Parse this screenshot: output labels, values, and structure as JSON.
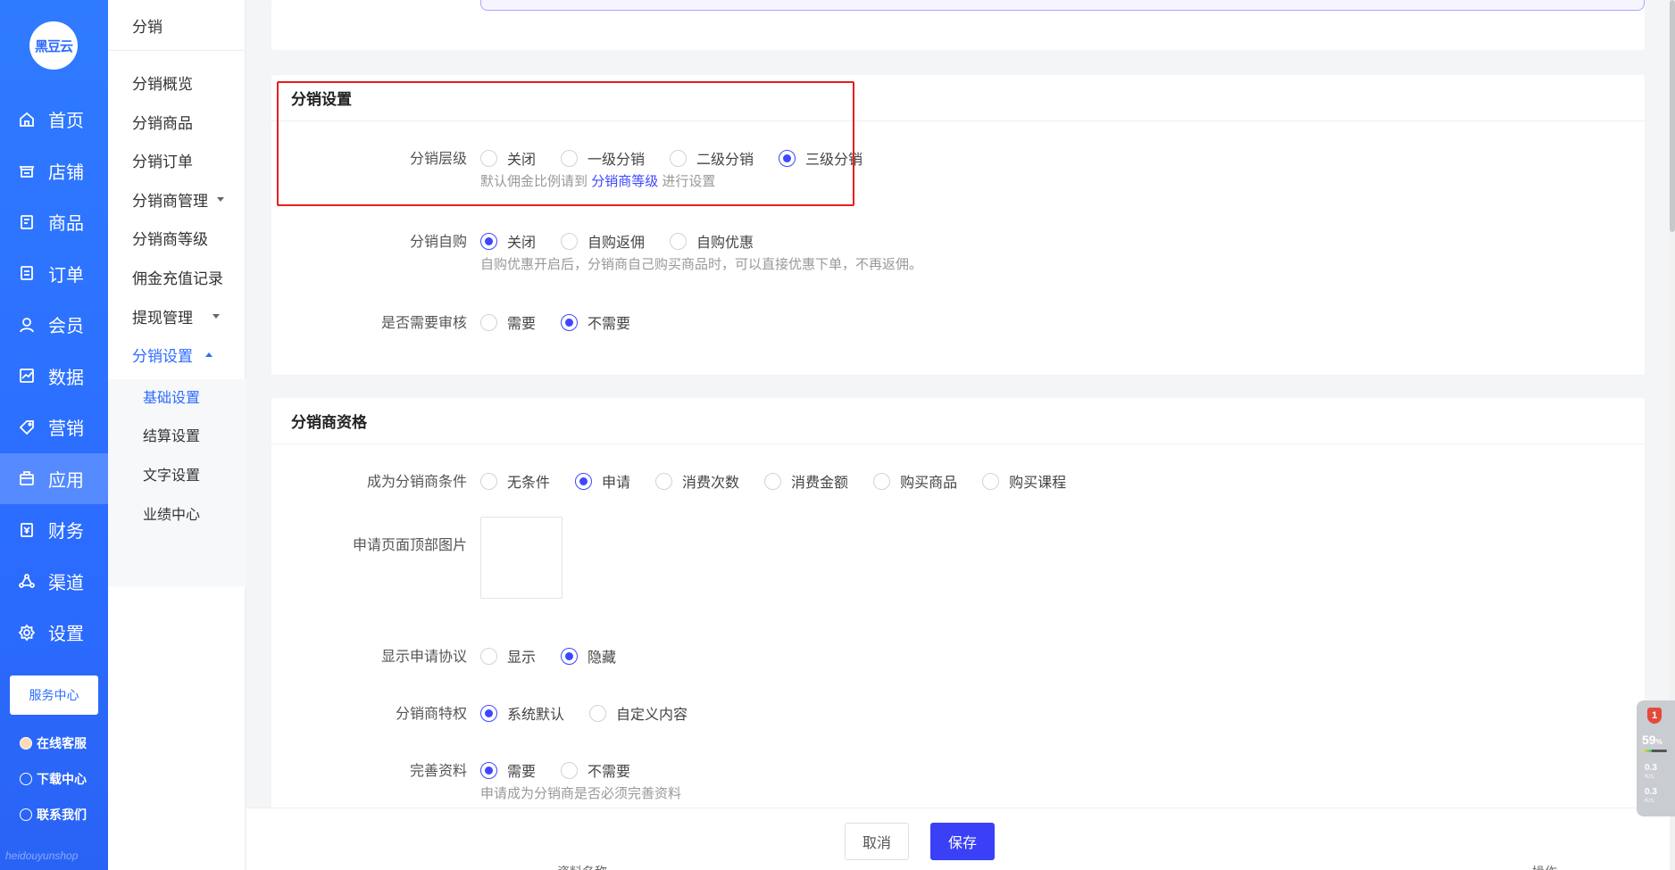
{
  "brand": {
    "logo_text": "黑豆云",
    "footer_text": "heidouyunshop"
  },
  "sidebar": {
    "items": [
      {
        "label": "首页",
        "icon": "home-icon"
      },
      {
        "label": "店铺",
        "icon": "shop-icon"
      },
      {
        "label": "商品",
        "icon": "goods-icon"
      },
      {
        "label": "订单",
        "icon": "order-icon"
      },
      {
        "label": "会员",
        "icon": "member-icon"
      },
      {
        "label": "数据",
        "icon": "data-icon"
      },
      {
        "label": "营销",
        "icon": "tag-icon"
      },
      {
        "label": "应用",
        "icon": "app-icon",
        "active": true
      },
      {
        "label": "财务",
        "icon": "finance-icon"
      },
      {
        "label": "渠道",
        "icon": "channel-icon"
      },
      {
        "label": "设置",
        "icon": "gear-icon"
      }
    ],
    "service_center": "服务中心",
    "online_service": "在线客服",
    "download_center": "下载中心",
    "contact_us": "联系我们"
  },
  "submenu": {
    "header": "分销",
    "items": [
      "分销概览",
      "分销商品",
      "分销订单",
      "分销商管理",
      "分销商等级",
      "佣金充值记录",
      "提现管理",
      "分销设置"
    ],
    "active_item": "分销设置",
    "sub_items": [
      "基础设置",
      "结算设置",
      "文字设置",
      "业绩中心"
    ],
    "active_sub": "基础设置"
  },
  "distribution_settings": {
    "title": "分销设置",
    "level": {
      "label": "分销层级",
      "options": [
        "关闭",
        "一级分销",
        "二级分销",
        "三级分销"
      ],
      "selected": "三级分销",
      "hint_prefix": "默认佣金比例请到",
      "hint_link": "分销商等级",
      "hint_suffix": "进行设置"
    },
    "self_purchase": {
      "label": "分销自购",
      "options": [
        "关闭",
        "自购返佣",
        "自购优惠"
      ],
      "selected": "关闭",
      "hint": "自购优惠开启后，分销商自己购买商品时，可以直接优惠下单，不再返佣。"
    },
    "review": {
      "label": "是否需要审核",
      "options": [
        "需要",
        "不需要"
      ],
      "selected": "不需要"
    }
  },
  "qualification": {
    "title": "分销商资格",
    "condition": {
      "label": "成为分销商条件",
      "options": [
        "无条件",
        "申请",
        "消费次数",
        "消费金额",
        "购买商品",
        "购买课程"
      ],
      "selected": "申请"
    },
    "top_image": {
      "label": "申请页面顶部图片"
    },
    "agreement": {
      "label": "显示申请协议",
      "options": [
        "显示",
        "隐藏"
      ],
      "selected": "隐藏"
    },
    "privilege": {
      "label": "分销商特权",
      "options": [
        "系统默认",
        "自定义内容"
      ],
      "selected": "系统默认"
    },
    "complete_info": {
      "label": "完善资料",
      "options": [
        "需要",
        "不需要"
      ],
      "selected": "需要",
      "hint": "申请成为分销商是否必须完善资料"
    }
  },
  "footer": {
    "cancel": "取消",
    "save": "保存",
    "peek_left": "资料名称",
    "peek_right": "操作"
  },
  "net_widget": {
    "badge": "1",
    "percent": "59",
    "percent_unit": "%",
    "up": "0.3",
    "down": "0.3",
    "unit": "K/s"
  },
  "colors": {
    "sidebar": "#2b6dff",
    "accent": "#3e47ff",
    "highlight": "#e81d1d"
  }
}
